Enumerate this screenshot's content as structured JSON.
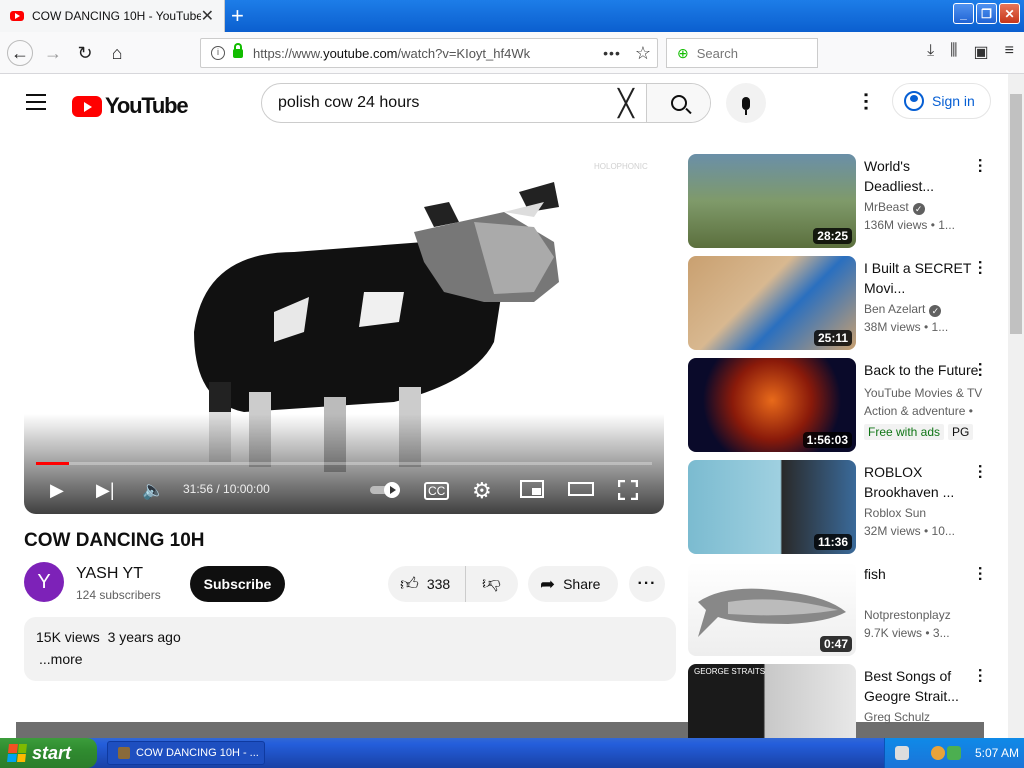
{
  "browser": {
    "tab_title": "COW DANCING 10H - YouTube",
    "tab_close": "✕",
    "new_tab": "+",
    "url_prefix": "https://www.",
    "url_domain": "youtube.com",
    "url_rest": "/watch?v=KIoyt_hf4Wk",
    "search_placeholder": "Search"
  },
  "youtube": {
    "logo_text": "YouTube",
    "search_query": "polish cow 24 hours",
    "sign_in": "Sign in"
  },
  "player": {
    "time_current": "31:56",
    "time_total": "10:00:00",
    "time_display": "31:56 / 10:00:00",
    "watermark": "HOLOPHONIC",
    "progress_fraction": 0.053
  },
  "video": {
    "title": "COW DANCING 10H",
    "channel_initial": "Y",
    "channel_name": "YASH YT",
    "subscribers": "124 subscribers",
    "subscribe_label": "Subscribe",
    "likes": "338",
    "share_label": "Share",
    "views": "15K views",
    "age": "3 years ago",
    "more_label": "...more"
  },
  "recommendations": [
    {
      "title": "World's Deadliest...",
      "channel": "MrBeast",
      "verified": true,
      "meta": "136M views • 1...",
      "duration": "28:25"
    },
    {
      "title": "I Built a SECRET Movi...",
      "channel": "Ben Azelart",
      "verified": true,
      "meta": "38M views • 1...",
      "duration": "25:11"
    },
    {
      "title": "Back to the Future",
      "channel": "YouTube Movies & TV",
      "verified": false,
      "meta": "Action & adventure •",
      "duration": "1:56:03",
      "badges": [
        "Free with ads",
        "PG"
      ]
    },
    {
      "title": "ROBLOX Brookhaven ...",
      "channel": "Roblox Sun",
      "verified": false,
      "meta": "32M views • 10...",
      "duration": "11:36"
    },
    {
      "title": "fish",
      "channel": "Notprestonplayz",
      "verified": false,
      "meta": "9.7K views • 3...",
      "duration": "0:47"
    },
    {
      "title": "Best Songs of Geogre Strait...",
      "channel": "Greg Schulz",
      "verified": false,
      "meta": "",
      "duration": "",
      "thumb_text": "GEORGE STRAITS"
    }
  ],
  "taskbar": {
    "start_label": "start",
    "task_title": "COW DANCING 10H - ...",
    "clock": "5:07 AM"
  },
  "colors": {
    "brand_red": "#ff0000",
    "link_blue": "#065fd4",
    "xp_taskbar": "#245edb",
    "xp_start": "#308c30"
  }
}
